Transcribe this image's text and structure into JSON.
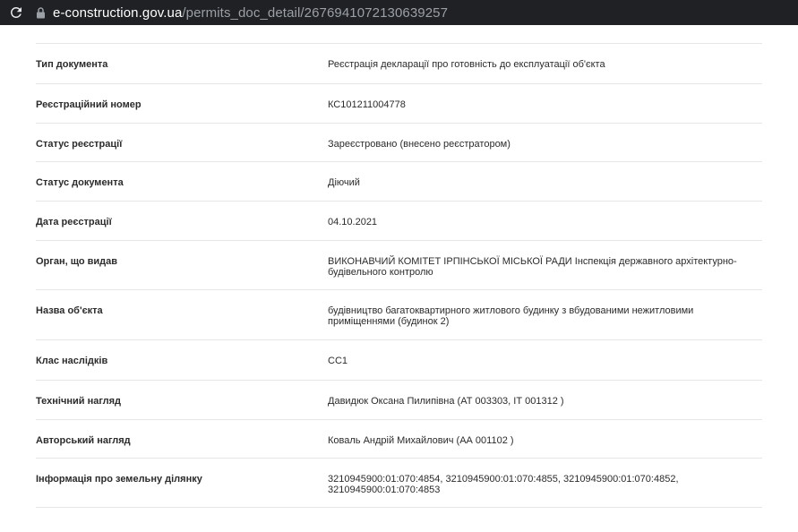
{
  "browser": {
    "url_domain": "e-construction.gov.ua",
    "url_path": "/permits_doc_detail/2676941072130639257"
  },
  "rows": [
    {
      "label": "Тип документа",
      "value": "Реєстрація декларації про готовність до експлуатації об'єкта"
    },
    {
      "label": "Реєстраційний номер",
      "value": "КС101211004778"
    },
    {
      "label": "Статус реєстрації",
      "value": "Зареєстровано (внесено реєстратором)"
    },
    {
      "label": "Статус документа",
      "value": "Діючий"
    },
    {
      "label": "Дата реєстрації",
      "value": "04.10.2021"
    },
    {
      "label": "Орган, що видав",
      "value": "ВИКОНАВЧИЙ КОМІТЕТ ІРПІНСЬКОЇ МІСЬКОЇ РАДИ Інспекція державного архітектурно-будівельного контролю"
    },
    {
      "label": "Назва об'єкта",
      "value": "будівництво багатоквартирного житлового будинку з вбудованими нежитловими приміщеннями (будинок 2)"
    },
    {
      "label": "Клас наслідків",
      "value": "СС1"
    },
    {
      "label": "Технічний нагляд",
      "value": "Давидюк Оксана Пилипівна (АТ 003303, ІТ 001312 )"
    },
    {
      "label": "Авторський нагляд",
      "value": "Коваль Андрій Михайлович (АА 001102 )"
    },
    {
      "label": "Інформація про земельну ділянку",
      "value": "3210945900:01:070:4854, 3210945900:01:070:4855, 3210945900:01:070:4852, 3210945900:01:070:4853"
    }
  ]
}
